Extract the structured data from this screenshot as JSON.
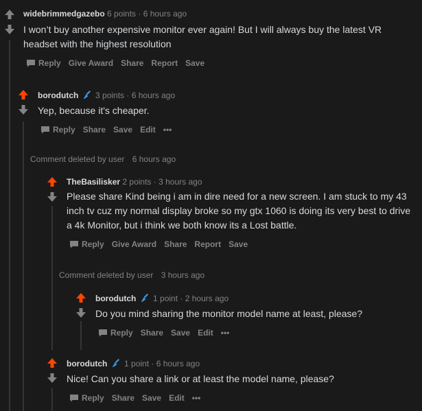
{
  "comments": [
    {
      "author": "widebrimmedgazebo",
      "points": "6 points",
      "time": "6 hours ago",
      "body": "I won’t buy another expensive monitor ever again! But I will always buy the latest VR headset with the highest resolution",
      "actions": [
        "Reply",
        "Give Award",
        "Share",
        "Report",
        "Save"
      ],
      "upvoted": false
    },
    {
      "author": "borodutch",
      "points": "3 points",
      "time": "6 hours ago",
      "body": "Yep, because it's cheaper.",
      "actions": [
        "Reply",
        "Share",
        "Save",
        "Edit",
        "•••"
      ],
      "upvoted": true
    },
    {
      "author": "TheBasilisker",
      "points": "2 points",
      "time": "3 hours ago",
      "body": "Please share Kind being i am in dire need for a new screen. I am stuck to my 43 inch tv cuz my normal display broke so my gtx 1060 is doing its very best to drive a 4k Monitor, but i think we both know its a Lost battle.",
      "actions": [
        "Reply",
        "Give Award",
        "Share",
        "Report",
        "Save"
      ],
      "upvoted": true
    },
    {
      "author": "borodutch",
      "points": "1 point",
      "time": "2 hours ago",
      "body": "Do you mind sharing the monitor model name at least, please?",
      "actions": [
        "Reply",
        "Share",
        "Save",
        "Edit",
        "•••"
      ],
      "upvoted": true
    },
    {
      "author": "borodutch",
      "points": "1 point",
      "time": "6 hours ago",
      "body": "Nice! Can you share a link or at least the model name, please?",
      "actions": [
        "Reply",
        "Share",
        "Save",
        "Edit",
        "•••"
      ],
      "upvoted": true
    }
  ],
  "deleted": [
    {
      "label": "Comment deleted by user",
      "time": "6 hours ago"
    },
    {
      "label": "Comment deleted by user",
      "time": "3 hours ago"
    }
  ],
  "colors": {
    "upvote": "#ff4500",
    "neutral": "#818384",
    "background": "#1a1a1b",
    "text": "#d7dadc",
    "line": "#343536",
    "mic": "#3d9be9"
  },
  "icons": {
    "upvote": "upvote-arrow-icon",
    "downvote": "downvote-arrow-icon",
    "reply": "speech-bubble-icon",
    "mic": "microphone-icon"
  }
}
